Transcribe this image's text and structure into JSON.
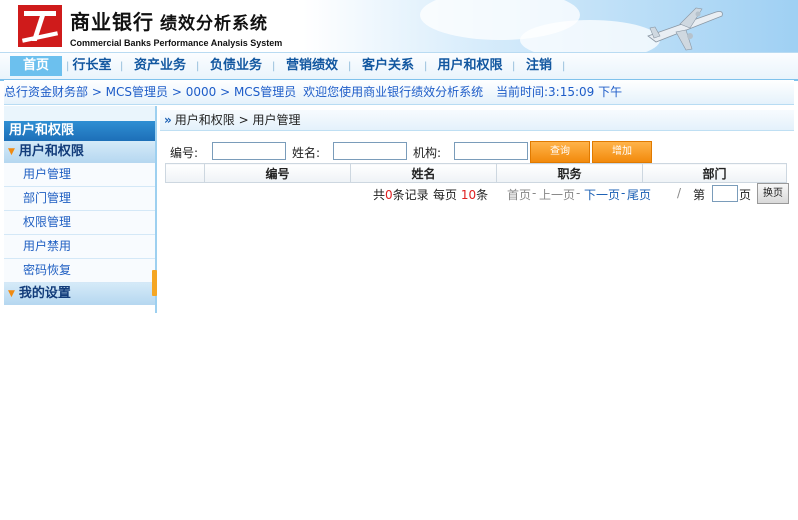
{
  "header": {
    "title": "商业银行",
    "title_sub": "绩效分析系统",
    "subtitle": "Commercial Banks  Performance Analysis System"
  },
  "nav": {
    "items": [
      "首页",
      "行长室",
      "资产业务",
      "负债业务",
      "营销绩效",
      "客户关系",
      "用户和权限",
      "注销"
    ],
    "active_index": 0
  },
  "status": {
    "path": "总行资金财务部 > MCS管理员 > 0000 > MCS管理员",
    "welcome": "欢迎您使用商业银行绩效分析系统",
    "time_label": "当前时间:",
    "time_value": "3:15:09 下午"
  },
  "sidebar": {
    "title": "用户和权限",
    "groups": [
      {
        "label": "用户和权限",
        "items": [
          "用户管理",
          "部门管理",
          "权限管理",
          "用户禁用",
          "密码恢复"
        ]
      },
      {
        "label": "我的设置"
      }
    ]
  },
  "content": {
    "breadcrumb": "用户和权限  > 用户管理",
    "search": {
      "id_label": "编号:",
      "name_label": "姓名:",
      "org_label": "机构:",
      "query_button": "查询",
      "add_button": "增加"
    },
    "table": {
      "columns": [
        "",
        "编号",
        "姓名",
        "职务",
        "部门"
      ]
    },
    "pager": {
      "total_prefix": "共",
      "total_count": "0",
      "total_suffix": "条记录",
      "per_page_prefix": "每页",
      "per_page_count": "10",
      "per_page_suffix": "条",
      "first": "首页",
      "prev": "上一页",
      "next": "下一页",
      "last": "尾页",
      "sep": "-",
      "slash": "/",
      "page_prefix": "第",
      "page_suffix": "页",
      "go_button": "换页"
    }
  },
  "colors": {
    "nav_active": "#6cc0ee",
    "link_blue": "#1a5fb4",
    "orange_button": "#f28a0c",
    "sidebar_title": "#1d6fb8"
  }
}
